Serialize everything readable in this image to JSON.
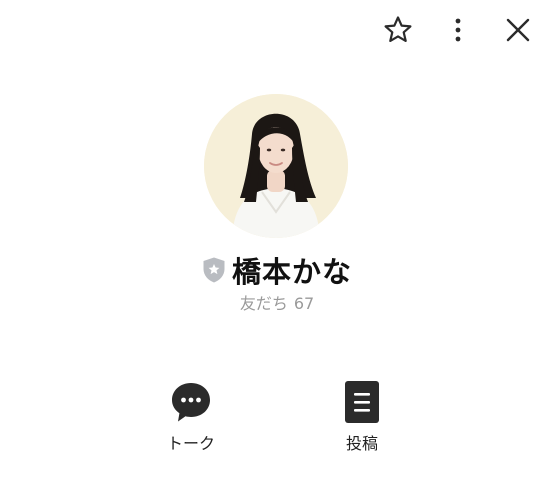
{
  "header": {
    "icons": [
      "star-icon",
      "more-vertical-icon",
      "close-icon"
    ]
  },
  "profile": {
    "name": "橋本かな",
    "friends_label": "友だち",
    "friends_count": "67",
    "badge_icon": "official-shield-icon"
  },
  "actions": [
    {
      "label": "トーク",
      "icon": "chat-bubble-icon"
    },
    {
      "label": "投稿",
      "icon": "post-list-icon"
    }
  ],
  "colors": {
    "background": "#ffffff",
    "icon_dark": "#2b2b2b",
    "muted_text": "#9a9a9a",
    "shield": "#b9bcc1",
    "avatar_bg": "#f6efd8"
  }
}
